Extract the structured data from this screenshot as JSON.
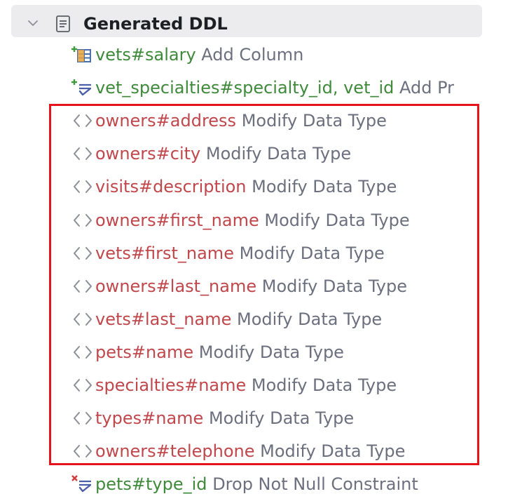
{
  "tree": {
    "root": {
      "label": "Generated DDL",
      "expanded": true
    },
    "rows": [
      {
        "object": "vets#salary",
        "action": "Add Column",
        "object_color": "green",
        "icon": "add-column-icon"
      },
      {
        "object": "vet_specialties#specialty_id, vet_id",
        "action": "Add Pr",
        "object_color": "green",
        "icon": "add-primary-key-icon"
      },
      {
        "object": "owners#address",
        "action": "Modify Data Type",
        "object_color": "red",
        "icon": "modify-data-type-icon"
      },
      {
        "object": "owners#city",
        "action": "Modify Data Type",
        "object_color": "red",
        "icon": "modify-data-type-icon"
      },
      {
        "object": "visits#description",
        "action": "Modify Data Type",
        "object_color": "red",
        "icon": "modify-data-type-icon"
      },
      {
        "object": "owners#first_name",
        "action": "Modify Data Type",
        "object_color": "red",
        "icon": "modify-data-type-icon"
      },
      {
        "object": "vets#first_name",
        "action": "Modify Data Type",
        "object_color": "red",
        "icon": "modify-data-type-icon"
      },
      {
        "object": "owners#last_name",
        "action": "Modify Data Type",
        "object_color": "red",
        "icon": "modify-data-type-icon"
      },
      {
        "object": "vets#last_name",
        "action": "Modify Data Type",
        "object_color": "red",
        "icon": "modify-data-type-icon"
      },
      {
        "object": "pets#name",
        "action": "Modify Data Type",
        "object_color": "red",
        "icon": "modify-data-type-icon"
      },
      {
        "object": "specialties#name",
        "action": "Modify Data Type",
        "object_color": "red",
        "icon": "modify-data-type-icon"
      },
      {
        "object": "types#name",
        "action": "Modify Data Type",
        "object_color": "red",
        "icon": "modify-data-type-icon"
      },
      {
        "object": "owners#telephone",
        "action": "Modify Data Type",
        "object_color": "red",
        "icon": "modify-data-type-icon"
      },
      {
        "object": "pets#type_id",
        "action": "Drop Not Null Constraint",
        "object_color": "green",
        "icon": "drop-not-null-icon"
      }
    ]
  },
  "colors": {
    "object_green": "#3f8a3a",
    "object_red": "#c0474b",
    "action_gray": "#6c707e",
    "highlight_border": "#e5131b",
    "header_bg": "#ececee"
  }
}
